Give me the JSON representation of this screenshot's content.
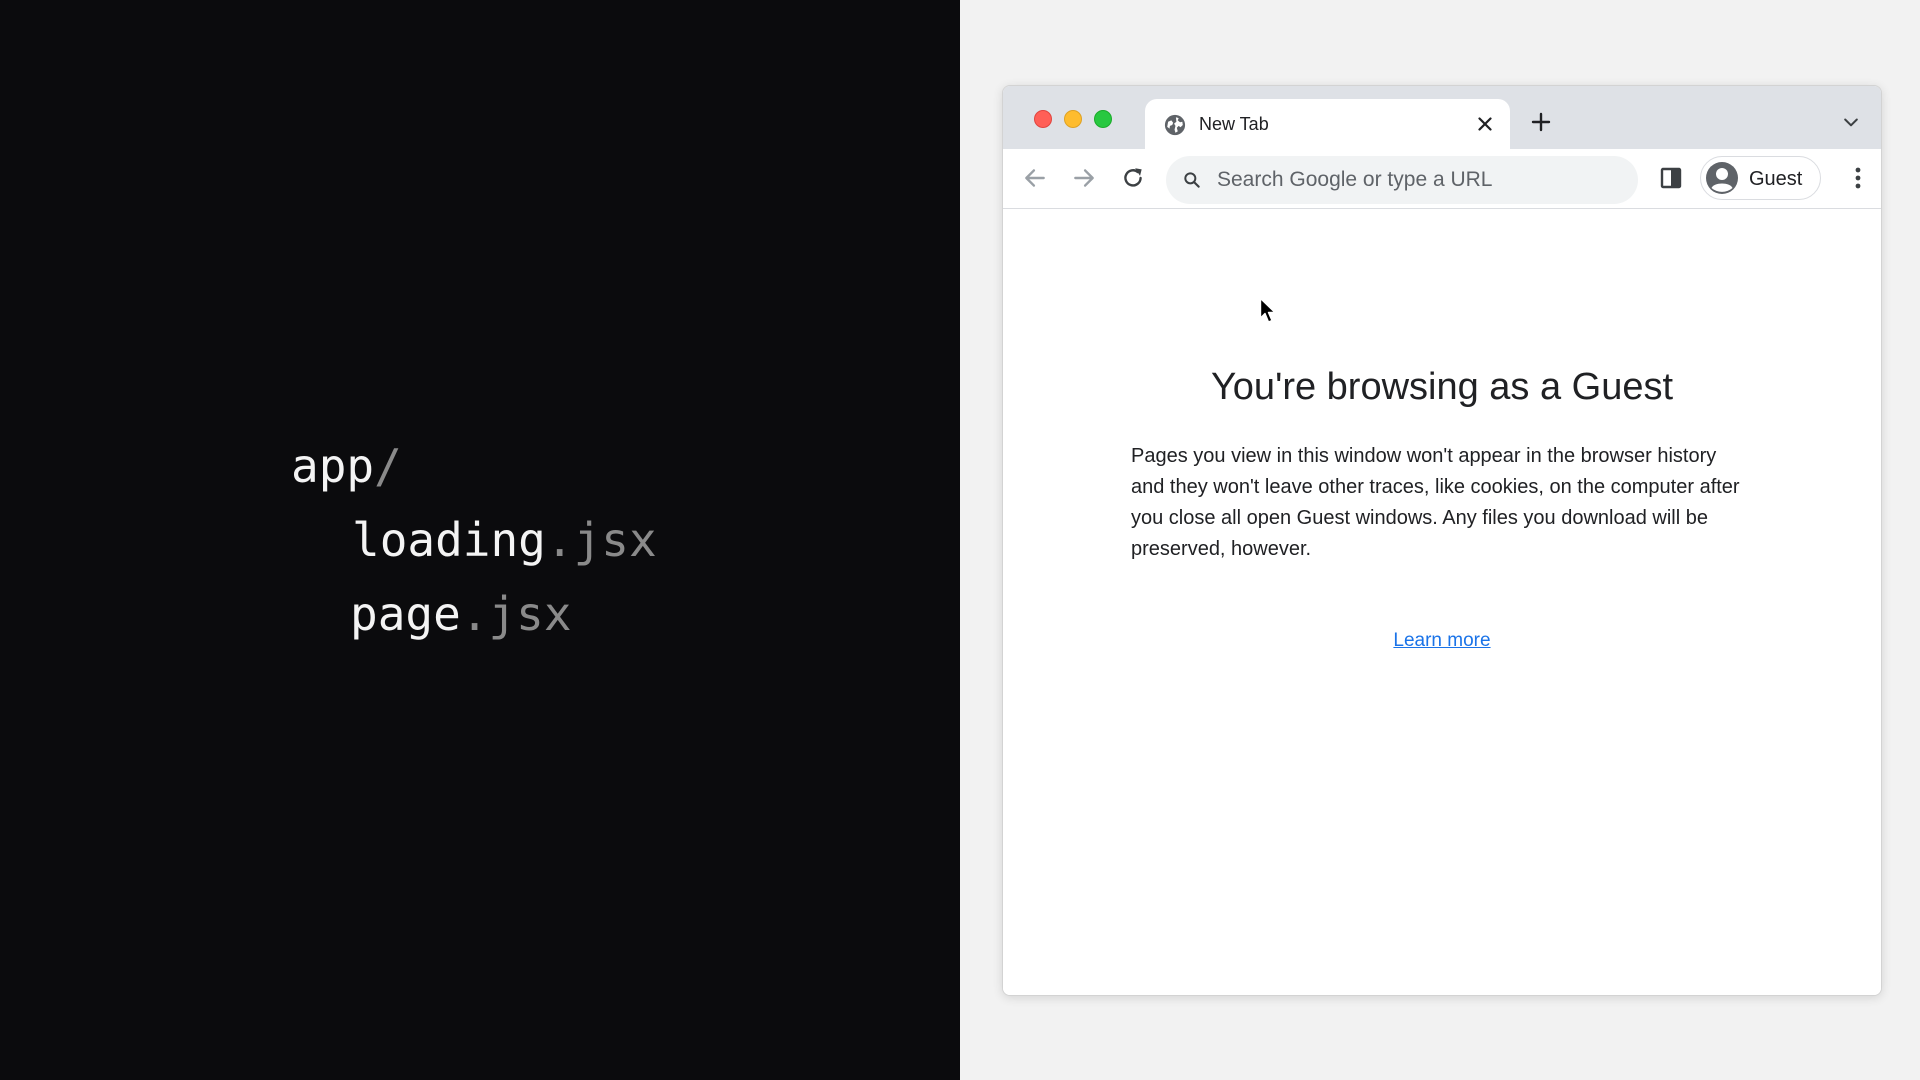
{
  "code_panel": {
    "lines": [
      {
        "name": "app",
        "dim": "/"
      },
      {
        "name": "loading",
        "dim": ".jsx"
      },
      {
        "name": "page",
        "dim": ".jsx"
      }
    ]
  },
  "browser": {
    "tab": {
      "title": "New Tab"
    },
    "toolbar": {
      "omnibox_placeholder": "Search Google or type a URL",
      "profile_label": "Guest"
    },
    "content": {
      "title": "You're browsing as a Guest",
      "description": "Pages you view in this window won't appear in the browser history and they won't leave other traces, like cookies, on the computer after you close all open Guest windows. Any files you download will be preserved, however.",
      "link": "Learn more"
    }
  },
  "colors": {
    "left_background": "#0b0b0d",
    "code_text": "#f4f4f4",
    "code_dim": "#8a8a8a",
    "tabstrip": "#dee1e6",
    "link": "#1a73e8"
  },
  "icons": {
    "tab": "globe-icon",
    "close": "close-icon",
    "new_tab": "plus-icon",
    "dropdown": "chevron-down-icon",
    "back": "arrow-back-icon",
    "forward": "arrow-forward-icon",
    "reload": "reload-icon",
    "search": "search-icon",
    "side_panel": "side-panel-icon",
    "avatar": "avatar-icon",
    "menu": "kebab-menu-icon"
  }
}
